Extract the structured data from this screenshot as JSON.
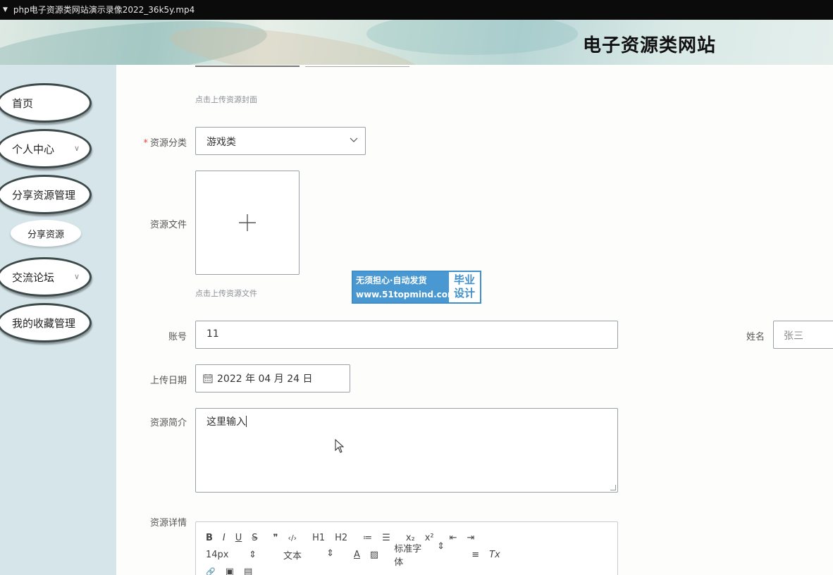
{
  "video_bar": {
    "filename": "php电子资源类网站演示录像2022_36k5y.mp4"
  },
  "header": {
    "site_title": "电子资源类网站"
  },
  "sidebar": {
    "items": [
      {
        "label": "首页"
      },
      {
        "label": "个人中心"
      },
      {
        "label": "分享资源管理"
      },
      {
        "label": "交流论坛"
      },
      {
        "label": "我的收藏管理"
      }
    ],
    "sub_items": [
      {
        "label": "分享资源"
      }
    ]
  },
  "form": {
    "cover_hint": "点击上传资源封面",
    "category_label": "资源分类",
    "category_required_mark": "*",
    "category_value": "游戏类",
    "file_label": "资源文件",
    "file_hint": "点击上传资源文件",
    "account_label": "账号",
    "account_value": "11",
    "name_label": "姓名",
    "name_value": "张三",
    "date_label": "上传日期",
    "date_value": "2022 年 04 月 24 日",
    "intro_label": "资源简介",
    "intro_value": "这里输入",
    "detail_label": "资源详情"
  },
  "editor_toolbar": {
    "row1": [
      "B",
      "I",
      "U",
      "S",
      "❞",
      "‹/›",
      "H1",
      "H2",
      "≔",
      "☰",
      "x₂",
      "x²",
      "⇤",
      "⇥"
    ],
    "font_size": "14px",
    "text_style": "文本",
    "font_family": "标准字体",
    "row2_icons": [
      "A",
      "▨",
      "≡",
      "Tx"
    ],
    "row3_icons": [
      "🔗",
      "▣",
      "▤"
    ]
  },
  "watermark": {
    "line1": "无须担心·自动发货",
    "line2": "www.51topmind.com",
    "badge1": "毕业",
    "badge2": "设计"
  }
}
